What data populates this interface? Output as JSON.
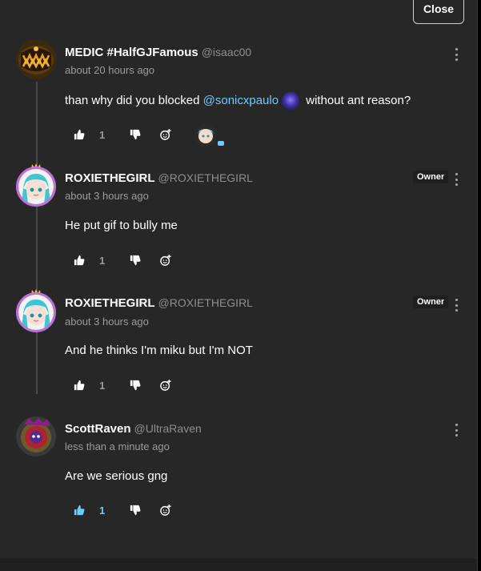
{
  "header": {
    "close_label": "Close"
  },
  "comments": [
    {
      "username": "MEDIC #HalfGJFamous",
      "handle": "@isaac00",
      "time": "about 20 hours ago",
      "message_before": "than why did you blocked ",
      "mention": "@sonicxpaulo",
      "message_after": " without ant reason?",
      "likes": "1",
      "has_reaction": true
    },
    {
      "username": "ROXIETHEGIRL",
      "handle": "@ROXIETHEGIRL",
      "time": "about 3 hours ago",
      "message": "He put gif to bully me",
      "likes": "1",
      "badge": "Owner"
    },
    {
      "username": "ROXIETHEGIRL",
      "handle": "@ROXIETHEGIRL",
      "time": "about 3 hours ago",
      "message": "And he thinks I'm miku but I'm NOT",
      "likes": "1",
      "badge": "Owner"
    },
    {
      "username": "ScottRaven",
      "handle": "@UltraRaven",
      "time": "less than a minute ago",
      "message": "Are we serious gng",
      "likes": "1",
      "liked": true
    }
  ],
  "icons": {
    "like": "thumbs-up-icon",
    "dislike": "thumbs-down-icon",
    "react": "add-reaction-icon",
    "more": "more-options-icon"
  },
  "colors": {
    "background": "#272727",
    "mention": "#6ecaff",
    "muted": "#9b9b9b"
  }
}
